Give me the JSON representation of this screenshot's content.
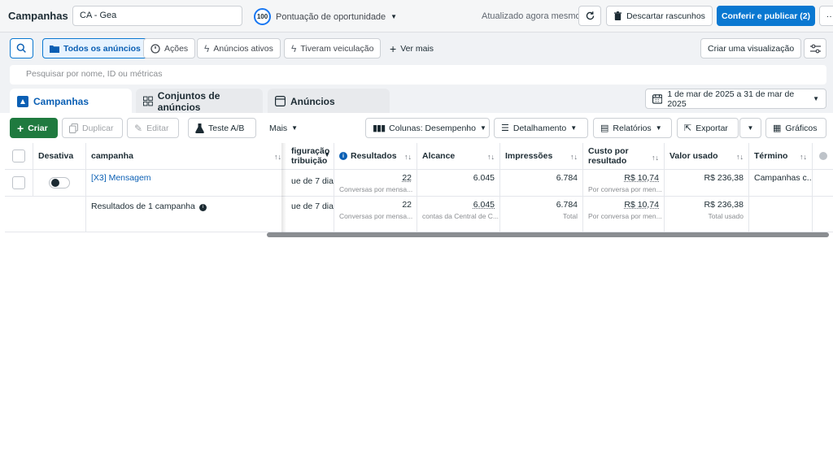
{
  "header": {
    "title": "Campanhas",
    "account": "CA - Gea",
    "score_value": "100",
    "score_label": "Pontuação de oportunidade",
    "updated": "Atualizado agora mesmo",
    "discard_label": "Descartar rascunhos",
    "publish_label": "Conferir e publicar (2)",
    "more_label": "···"
  },
  "filters": {
    "all_ads": "Todos os anúncios",
    "actions": "Ações",
    "active_ads": "Anúncios ativos",
    "had_delivery": "Tiveram veiculação",
    "see_more": "Ver mais",
    "create_view": "Criar uma visualização",
    "search_placeholder": "Pesquisar por nome, ID ou métricas"
  },
  "tabs": [
    {
      "label": "Campanhas"
    },
    {
      "label": "Conjuntos de anúncios"
    },
    {
      "label": "Anúncios"
    }
  ],
  "date_range": "1 de mar de 2025 a 31 de mar de 2025",
  "toolbar": {
    "create": "Criar",
    "duplicate": "Duplicar",
    "edit": "Editar",
    "ab_test": "Teste A/B",
    "more": "Mais",
    "columns": "Colunas: Desempenho",
    "breakdown": "Detalhamento",
    "reports": "Relatórios",
    "export": "Exportar",
    "charts": "Gráficos"
  },
  "table": {
    "headers": {
      "toggle": "Desativa",
      "campaign": "campanha",
      "attribution_line1": "figuração",
      "attribution_line2": "tribuição",
      "results": "Resultados",
      "reach": "Alcance",
      "impressions": "Impressões",
      "cost_line1": "Custo por",
      "cost_line2": "resultado",
      "amount_spent": "Valor usado",
      "end": "Término"
    },
    "row": {
      "campaign": "[X3] Mensagem",
      "attribution": "ue de 7 dia...",
      "results": "22",
      "results_sub": "Conversas por mensa...",
      "reach": "6.045",
      "impressions": "6.784",
      "cost": "R$ 10,74",
      "cost_sub": "Por conversa por men...",
      "amount_spent": "R$ 236,38",
      "end": "Campanhas c..."
    },
    "summary": {
      "label": "Resultados de 1 campanha",
      "attribution": "ue de 7 dia...",
      "results": "22",
      "results_sub": "Conversas por mensa...",
      "reach": "6.045",
      "reach_sub": "contas da Central de C...",
      "impressions": "6.784",
      "impressions_sub": "Total",
      "cost": "R$ 10,74",
      "cost_sub": "Por conversa por men...",
      "amount_spent": "R$ 236,38",
      "amount_spent_sub": "Total usado"
    }
  }
}
